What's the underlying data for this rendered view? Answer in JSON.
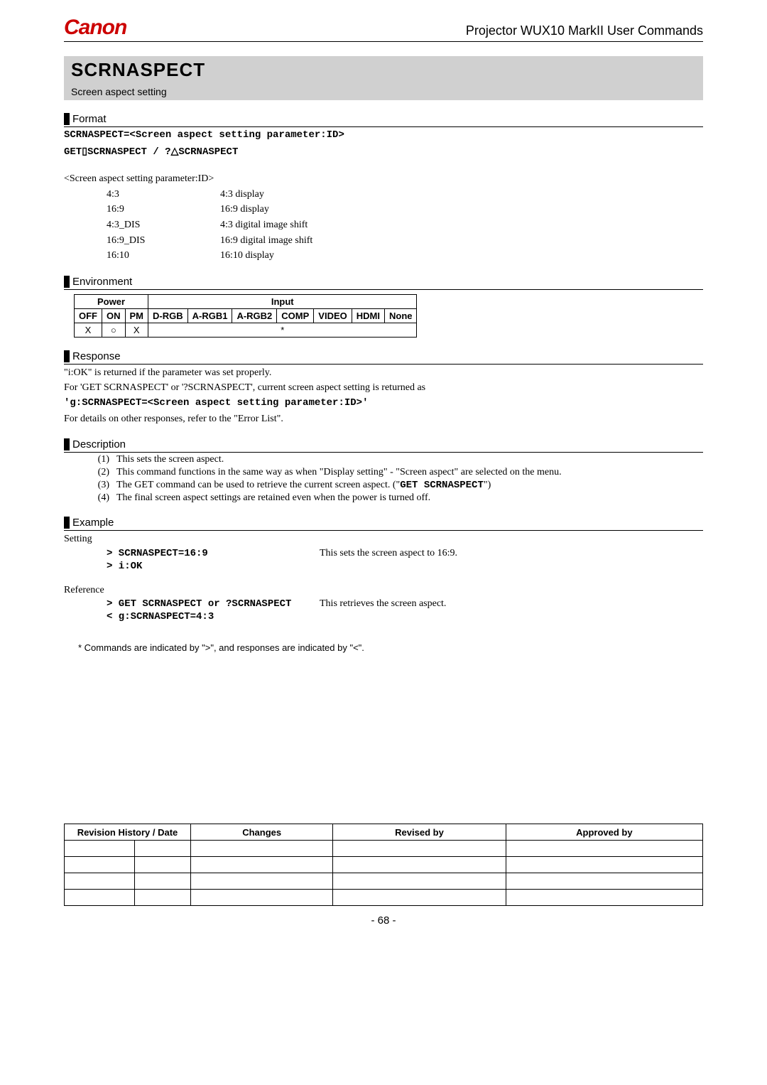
{
  "header": {
    "brand": "Canon",
    "doc": "Projector WUX10 MarkII User Commands"
  },
  "command": {
    "name": "SCRNASPECT",
    "subtitle": "Screen aspect setting"
  },
  "format": {
    "heading": "Format",
    "line1": "SCRNASPECT=<Screen aspect setting parameter:ID>",
    "line2a": "GET",
    "line2b": "SCRNASPECT   /   ?",
    "line2c": "SCRNASPECT",
    "param_title": "<Screen aspect setting parameter:ID>",
    "params": [
      {
        "k": "4:3",
        "v": "4:3 display"
      },
      {
        "k": "16:9",
        "v": "16:9 display"
      },
      {
        "k": "4:3_DIS",
        "v": "4:3 digital image shift"
      },
      {
        "k": "16:9_DIS",
        "v": "16:9 digital image shift"
      },
      {
        "k": "16:10",
        "v": "16:10 display"
      }
    ]
  },
  "environment": {
    "heading": "Environment",
    "group_power": "Power",
    "group_input": "Input",
    "cols": [
      "OFF",
      "ON",
      "PM",
      "D-RGB",
      "A-RGB1",
      "A-RGB2",
      "COMP",
      "VIDEO",
      "HDMI",
      "None"
    ],
    "row": [
      "X",
      "○",
      "X",
      "*",
      "*",
      "*",
      "*",
      "*",
      "*",
      "*"
    ],
    "merged_input": "*"
  },
  "response": {
    "heading": "Response",
    "l1": "\"i:OK\" is returned if the parameter was set properly.",
    "l2": "For 'GET SCRNASPECT' or '?SCRNASPECT', current screen aspect setting is returned as",
    "code": "'g:SCRNASPECT=<Screen aspect setting parameter:ID>'",
    "l3": "For details on other responses, refer to the \"Error List\"."
  },
  "description": {
    "heading": "Description",
    "items": [
      {
        "n": "(1)",
        "t": "This sets the screen aspect."
      },
      {
        "n": "(2)",
        "t": "This command functions in the same way as when \"Display setting\" - \"Screen aspect\" are selected on the menu."
      },
      {
        "n": "(3)",
        "t": "The GET command can be used to retrieve the current screen aspect. (\"",
        "code": "GET SCRNASPECT",
        "t2": "\")"
      },
      {
        "n": "(4)",
        "t": "The final screen aspect settings are retained even when the power is turned off."
      }
    ]
  },
  "example": {
    "heading": "Example",
    "setting_label": "Setting",
    "setting": [
      {
        "cmd": "> SCRNASPECT=16:9",
        "note": "This sets the screen aspect to 16:9."
      },
      {
        "cmd": "> i:OK",
        "note": ""
      }
    ],
    "reference_label": "Reference",
    "reference": [
      {
        "cmd": "> GET SCRNASPECT or ?SCRNASPECT",
        "note": "This retrieves the screen aspect."
      },
      {
        "cmd": "< g:SCRNASPECT=4:3",
        "note": ""
      }
    ]
  },
  "footnote": "* Commands are indicated by \">\", and responses are indicated by \"<\".",
  "revision": {
    "headers": [
      "Revision History / Date",
      "Changes",
      "Revised by",
      "Approved by"
    ],
    "rows": 4
  },
  "page_number": "- 68 -"
}
